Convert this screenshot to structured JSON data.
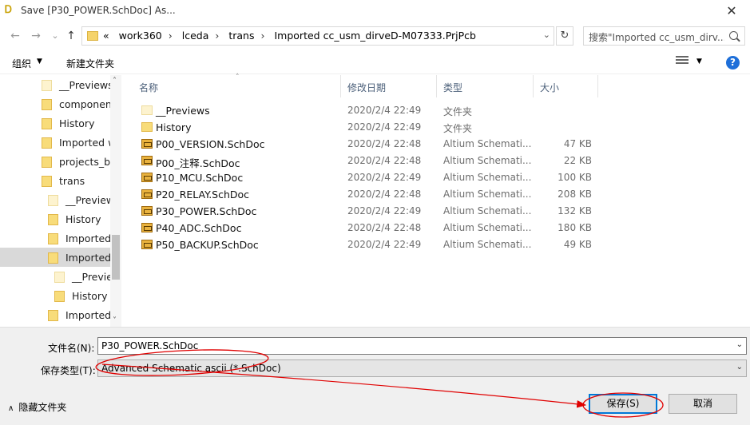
{
  "window": {
    "title": "Save [P30_POWER.SchDoc] As...",
    "close_glyph": "✕"
  },
  "nav": {
    "back": "←",
    "forward": "→",
    "recent": "⌄",
    "up": "↑"
  },
  "address": {
    "overflow": "«",
    "crumbs": [
      "work360",
      "lceda",
      "trans",
      "Imported cc_usm_dirveD-M07333.PrjPcb"
    ],
    "separator": "›"
  },
  "search": {
    "placeholder": "搜索\"Imported cc_usm_dirv..."
  },
  "toolbar": {
    "organize": "组织",
    "new_folder": "新建文件夹",
    "help": "?"
  },
  "tree": [
    {
      "label": "__Previews",
      "light": true
    },
    {
      "label": "componen",
      "light": false
    },
    {
      "label": "History",
      "light": false
    },
    {
      "label": "Imported w",
      "light": false
    },
    {
      "label": "projects_ba",
      "light": false
    },
    {
      "label": "trans",
      "light": false
    },
    {
      "label": "__Preview",
      "light": true
    },
    {
      "label": "History",
      "light": false
    },
    {
      "label": "Imported",
      "light": false
    },
    {
      "label": "Imported",
      "light": false,
      "selected": true
    },
    {
      "label": "__Previe",
      "light": true
    },
    {
      "label": "History",
      "light": false
    },
    {
      "label": "Imported",
      "light": false
    }
  ],
  "columns": {
    "name": "名称",
    "date": "修改日期",
    "type": "类型",
    "size": "大小"
  },
  "files": [
    {
      "name": "__Previews",
      "date": "2020/2/4 22:49",
      "type": "文件夹",
      "size": "",
      "kind": "folder-light"
    },
    {
      "name": "History",
      "date": "2020/2/4 22:49",
      "type": "文件夹",
      "size": "",
      "kind": "folder"
    },
    {
      "name": "P00_VERSION.SchDoc",
      "date": "2020/2/4 22:48",
      "type": "Altium Schemati...",
      "size": "47 KB",
      "kind": "sch"
    },
    {
      "name": "P00_注释.SchDoc",
      "date": "2020/2/4 22:48",
      "type": "Altium Schemati...",
      "size": "22 KB",
      "kind": "sch"
    },
    {
      "name": "P10_MCU.SchDoc",
      "date": "2020/2/4 22:49",
      "type": "Altium Schemati...",
      "size": "100 KB",
      "kind": "sch"
    },
    {
      "name": "P20_RELAY.SchDoc",
      "date": "2020/2/4 22:48",
      "type": "Altium Schemati...",
      "size": "208 KB",
      "kind": "sch"
    },
    {
      "name": "P30_POWER.SchDoc",
      "date": "2020/2/4 22:49",
      "type": "Altium Schemati...",
      "size": "132 KB",
      "kind": "sch"
    },
    {
      "name": "P40_ADC.SchDoc",
      "date": "2020/2/4 22:48",
      "type": "Altium Schemati...",
      "size": "180 KB",
      "kind": "sch"
    },
    {
      "name": "P50_BACKUP.SchDoc",
      "date": "2020/2/4 22:49",
      "type": "Altium Schemati...",
      "size": "49 KB",
      "kind": "sch"
    }
  ],
  "bottom": {
    "filename_label": "文件名(N):",
    "filename_value": "P30_POWER.SchDoc",
    "filetype_label": "保存类型(T):",
    "filetype_value": "Advanced Schematic ascii (*.SchDoc)",
    "hide_folders": "隐藏文件夹",
    "save": "保存(S)",
    "cancel": "取消"
  },
  "annotation_color": "#e00000"
}
